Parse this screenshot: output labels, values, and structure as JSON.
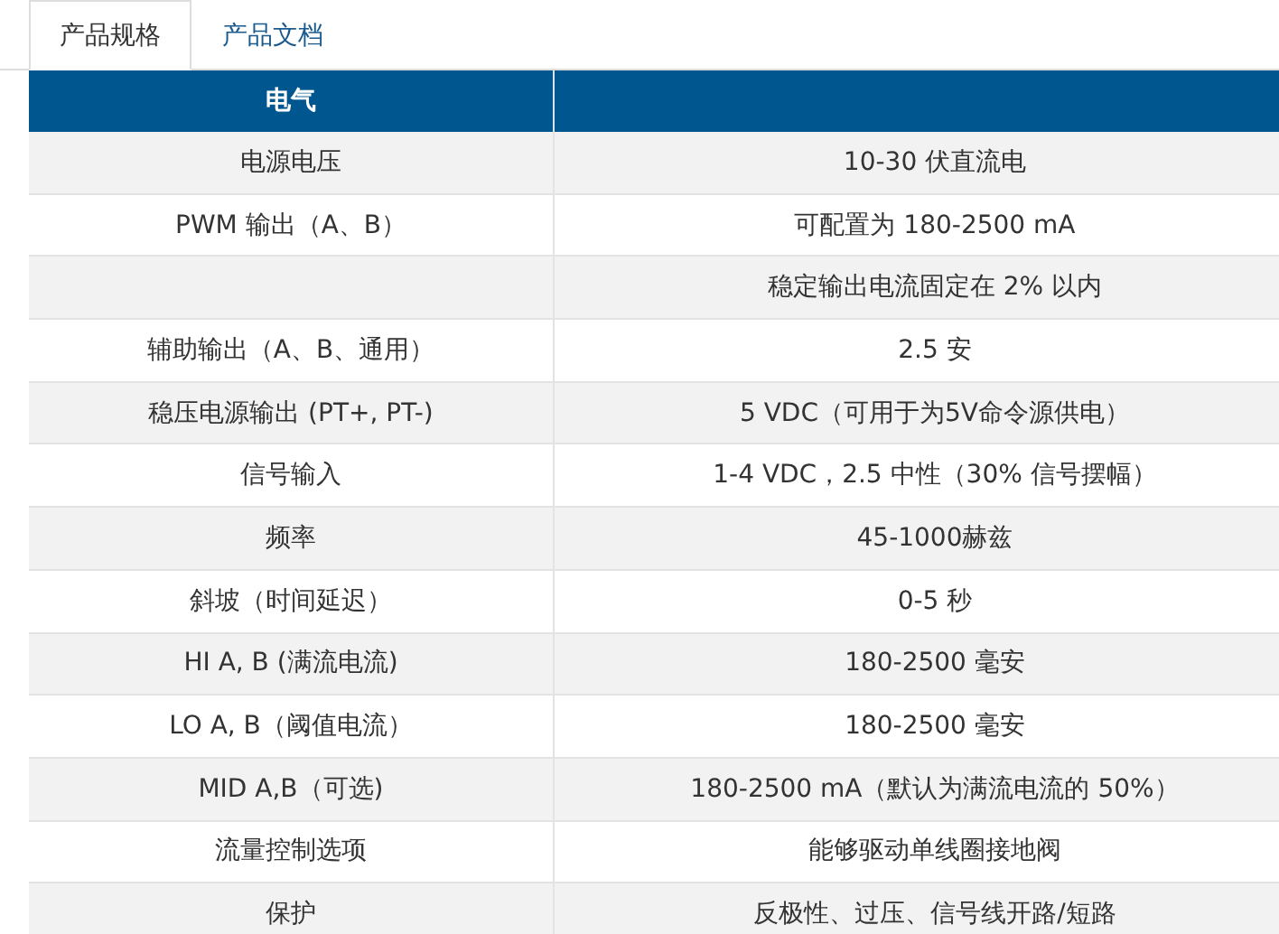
{
  "tabs": [
    {
      "label": "产品规格",
      "selected": true
    },
    {
      "label": "产品文档",
      "selected": false
    }
  ],
  "table": {
    "columns": [
      "电气"
    ],
    "rows": [
      {
        "parameter": "电源电压",
        "value": "10-30 伏直流电"
      },
      {
        "parameter": "PWM 输出（A、B）",
        "value": "可配置为 180-2500 mA"
      },
      {
        "value": "稳定输出电流固定在 2% 以内"
      },
      {
        "parameter": "辅助输出（A、B、通用）",
        "value": "2.5 安"
      },
      {
        "parameter": "稳压电源输出 (PT+, PT-)",
        "value": "5 VDC（可用于为5V命令源供电）"
      },
      {
        "parameter": "信号输入",
        "value": "1-4 VDC，2.5 中性（30% 信号摆幅）"
      },
      {
        "parameter": "频率",
        "value": "45-1000赫兹"
      },
      {
        "parameter": "斜坡（时间延迟）",
        "value": "0-5 秒"
      },
      {
        "parameter": "HI A, B (满流电流)",
        "value": "180-2500 毫安"
      },
      {
        "parameter": "LO A, B（阈值电流）",
        "value": "180-2500 毫安"
      },
      {
        "parameter": "MID A,B（可选)",
        "value": "180-2500 mA（默认为满流电流的 50%）"
      },
      {
        "parameter": "流量控制选项",
        "value": "能够驱动单线圈接地阀"
      },
      {
        "parameter": "保护",
        "value": "反极性、过压、信号线开路/短路"
      }
    ]
  }
}
